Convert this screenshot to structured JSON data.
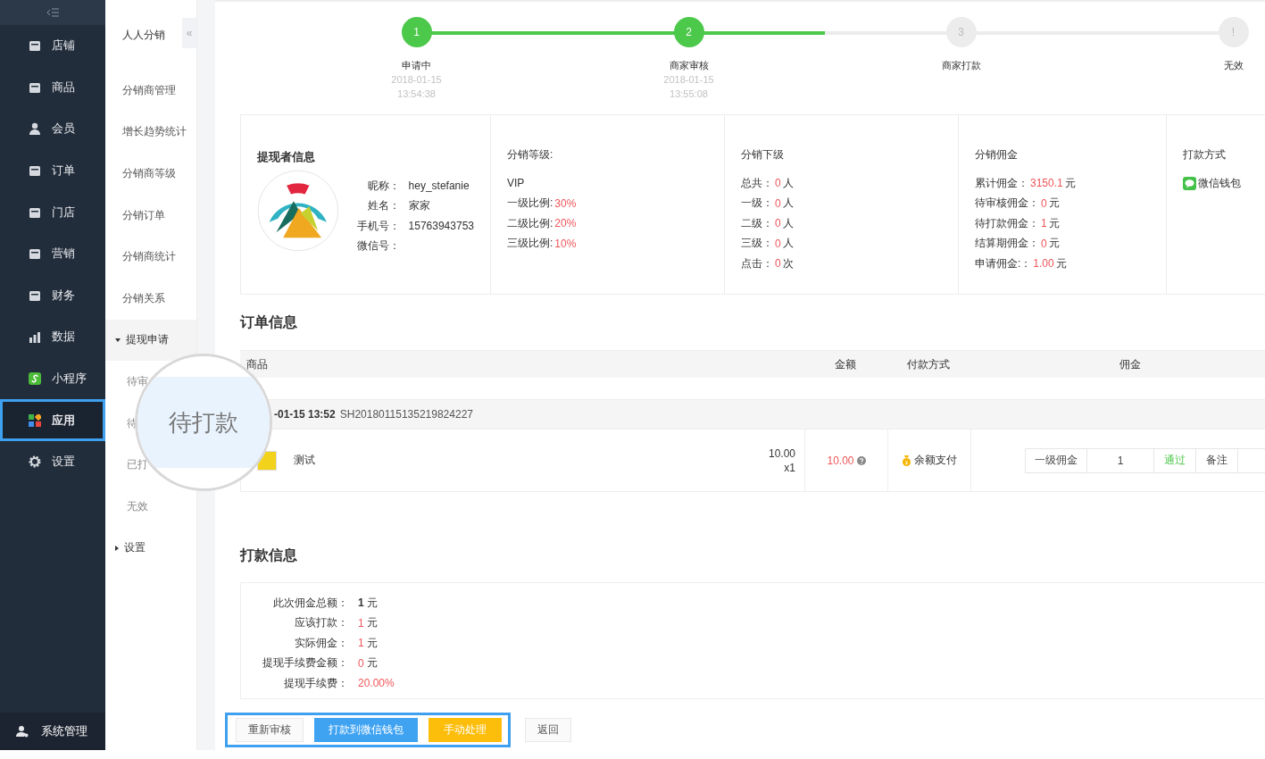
{
  "sidebar": {
    "items": [
      {
        "label": "店铺",
        "selected": false
      },
      {
        "label": "商品",
        "selected": false
      },
      {
        "label": "会员",
        "selected": false
      },
      {
        "label": "订单",
        "selected": false
      },
      {
        "label": "门店",
        "selected": false
      },
      {
        "label": "营销",
        "selected": false
      },
      {
        "label": "财务",
        "selected": false
      },
      {
        "label": "数据",
        "selected": false
      },
      {
        "label": "小程序",
        "selected": false
      },
      {
        "label": "应用",
        "selected": true
      },
      {
        "label": "设置",
        "selected": false
      }
    ],
    "footer": "系统管理"
  },
  "submenu": {
    "title": "人人分销",
    "collapse": "«",
    "items": [
      {
        "label": "分销商管理",
        "kind": "link"
      },
      {
        "label": "增长趋势统计",
        "kind": "link"
      },
      {
        "label": "分销商等级",
        "kind": "link"
      },
      {
        "label": "分销订单",
        "kind": "link"
      },
      {
        "label": "分销商统计",
        "kind": "link"
      },
      {
        "label": "分销关系",
        "kind": "link"
      },
      {
        "label": "提现申请",
        "kind": "group",
        "expanded": true,
        "children": [
          {
            "label": "待审"
          },
          {
            "label": "待"
          },
          {
            "label": "已打"
          },
          {
            "label": "无效"
          }
        ]
      },
      {
        "label": "设置",
        "kind": "group",
        "expanded": false
      }
    ]
  },
  "magnifier": {
    "text": "待打款"
  },
  "steps": [
    {
      "number": "1",
      "label": "申请中",
      "date": "2018-01-15",
      "time": "13:54:38",
      "done": true
    },
    {
      "number": "2",
      "label": "商家审核",
      "date": "2018-01-15",
      "time": "13:55:08",
      "done": true
    },
    {
      "number": "3",
      "label": "商家打款",
      "done": false
    },
    {
      "number": "!",
      "label": "无效",
      "done": false
    }
  ],
  "progress": {
    "level": 0.5
  },
  "applicant": {
    "title": "提现者信息",
    "fields": [
      {
        "label": "昵称：",
        "value": "hey_stefanie"
      },
      {
        "label": "姓名：",
        "value": "家家"
      },
      {
        "label": "手机号：",
        "value": "15763943753"
      },
      {
        "label": "微信号："
      }
    ]
  },
  "grade": {
    "title": "分销等级:",
    "name": "VIP",
    "rows": [
      {
        "label": "一级比例:",
        "value": "30%"
      },
      {
        "label": "二级比例:",
        "value": "20%"
      },
      {
        "label": "三级比例:",
        "value": "10%"
      }
    ]
  },
  "downline": {
    "title": "分销下级",
    "rows": [
      {
        "label": "总共：",
        "value": "0",
        "unit": "人"
      },
      {
        "label": "一级：",
        "value": "0",
        "unit": "人"
      },
      {
        "label": "二级：",
        "value": "0",
        "unit": "人"
      },
      {
        "label": "三级：",
        "value": "0",
        "unit": "人"
      },
      {
        "label": "点击：",
        "value": "0",
        "unit": "次"
      }
    ]
  },
  "commission": {
    "title": "分销佣金",
    "rows": [
      {
        "label": "累计佣金：",
        "value": "3150.1",
        "unit": "元"
      },
      {
        "label": "待审核佣金：",
        "value": "0",
        "unit": "元"
      },
      {
        "label": "待打款佣金：",
        "value": "1",
        "unit": "元"
      },
      {
        "label": "结算期佣金：",
        "value": "0",
        "unit": "元"
      },
      {
        "label": "申请佣金:：",
        "value": "1.00",
        "unit": "元"
      }
    ]
  },
  "pay_method": {
    "title": "打款方式",
    "method": "微信钱包"
  },
  "order": {
    "title": "订单信息",
    "columns": [
      "商品",
      "金额",
      "付款方式",
      "佣金"
    ],
    "date": "-01-15 13:52",
    "number": "SH20180115135219824227",
    "item": {
      "name": "测试",
      "price": "10.00",
      "quantity": "x1",
      "amount": "10.00",
      "payment": "余额支付",
      "commission_level": "一级佣金",
      "commission_value": "1",
      "action": "通过",
      "note": "备注"
    }
  },
  "payout": {
    "title": "打款信息",
    "rows": [
      {
        "label": "此次佣金总额：",
        "value": "1",
        "unit": "元",
        "kind": "total"
      },
      {
        "label": "应该打款：",
        "value": "1",
        "unit": "元",
        "kind": "amount"
      },
      {
        "label": "实际佣金：",
        "value": "1",
        "unit": "元",
        "kind": "amount"
      },
      {
        "label": "提现手续费金额：",
        "value": "0",
        "unit": "元",
        "kind": "amount"
      },
      {
        "label": "提现手续费：",
        "value": "20.00%",
        "kind": "amount"
      }
    ]
  },
  "button_groups": [
    {
      "highlighted": true,
      "buttons": [
        {
          "label": "重新审核",
          "kind": "default"
        },
        {
          "label": "打款到微信钱包",
          "kind": "primary"
        },
        {
          "label": "手动处理",
          "kind": "warning"
        }
      ]
    },
    {
      "highlighted": false,
      "buttons": [
        {
          "label": "返回",
          "kind": "default"
        }
      ]
    }
  ]
}
